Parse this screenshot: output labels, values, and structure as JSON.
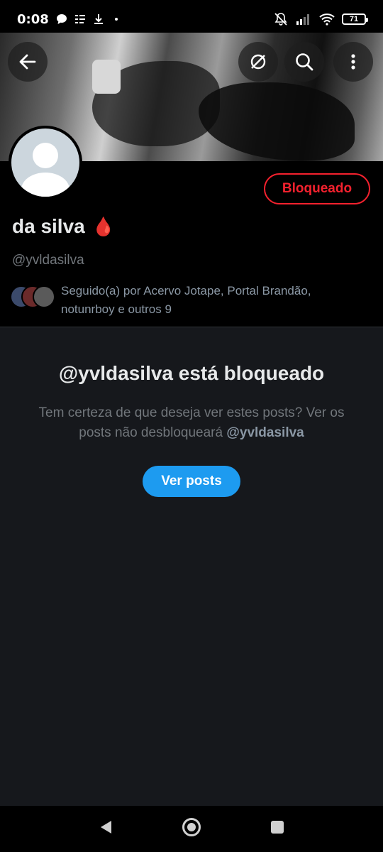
{
  "status_bar": {
    "time": "0:08",
    "battery": "71",
    "icons": [
      "chat-bubble-icon",
      "list-icon",
      "download-icon",
      "dot-icon",
      "muted-bell-icon",
      "signal-icon",
      "wifi-icon",
      "battery-icon"
    ]
  },
  "banner": {
    "buttons": [
      "back-arrow-icon",
      "no-sync-icon",
      "search-icon",
      "more-vertical-icon"
    ]
  },
  "profile": {
    "blocked_label": "Bloqueado",
    "display_name": "da silva",
    "name_emoji": "🩸",
    "handle": "@yvldasilva",
    "followed_by": "Seguido(a) por Acervo Jotape, Portal Brandão, notunrboy e outros 9"
  },
  "blocked_notice": {
    "title": "@yvldasilva está bloqueado",
    "desc_text": "Tem certeza de que deseja ver estes posts? Ver os posts não desbloqueará ",
    "desc_handle": "@yvldasilva",
    "button": "Ver posts"
  },
  "colors": {
    "accent": "#1d9bf0",
    "danger": "#f4212e",
    "background": "#16181c"
  }
}
